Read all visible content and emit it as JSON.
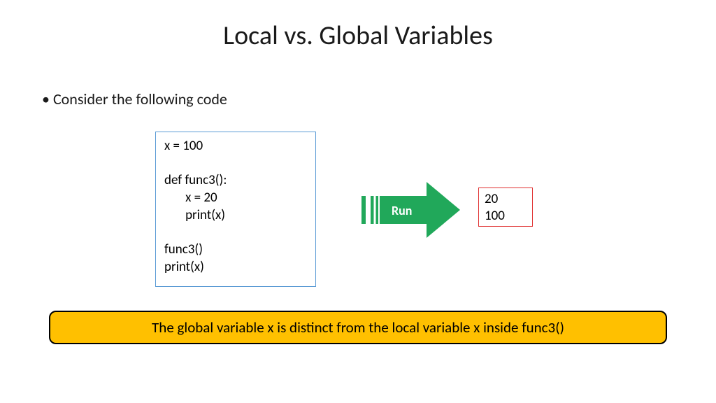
{
  "title": "Local vs. Global Variables",
  "bullet": "Consider the following code",
  "code": "x = 100\n\ndef func3():\n       x = 20\n       print(x)\n\nfunc3()\nprint(x)",
  "run_label": "Run",
  "output": "20\n100",
  "callout": "The global variable x is distinct from the local variable x inside func3()",
  "colors": {
    "arrow_fill": "#21a85a",
    "arrow_tail_stroke": "#ffffff",
    "code_border": "#5b9bd5",
    "output_border": "#e03030",
    "callout_bg": "#ffc000",
    "callout_border": "#000000"
  }
}
